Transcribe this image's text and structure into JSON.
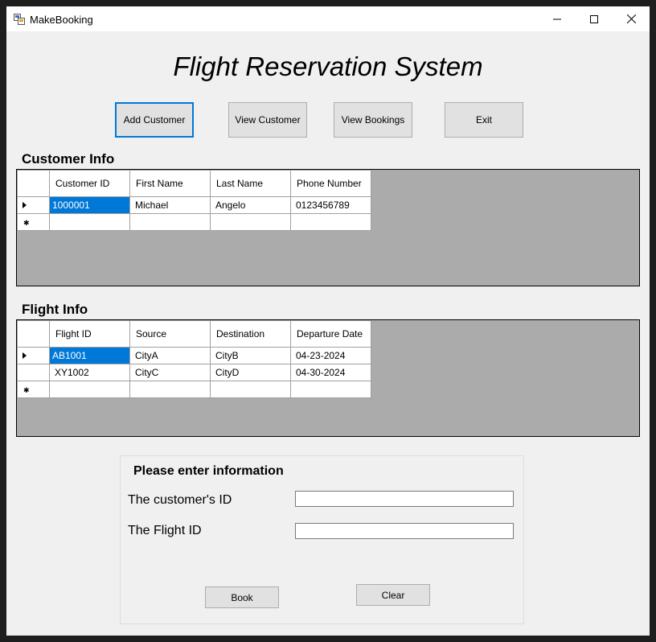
{
  "window": {
    "title": "MakeBooking",
    "controls": {
      "minimize": "—",
      "maximize": "☐",
      "close": "✕"
    }
  },
  "heading": "Flight Reservation System",
  "toolbar": {
    "add_customer": "Add Customer",
    "view_customer": "View Customer",
    "view_bookings": "View Bookings",
    "exit": "Exit"
  },
  "customer_info": {
    "title": "Customer Info",
    "columns": [
      "Customer ID",
      "First Name",
      "Last Name",
      "Phone Number"
    ],
    "rows": [
      [
        "1000001",
        "Michael",
        "Angelo",
        "0123456789"
      ]
    ]
  },
  "flight_info": {
    "title": "Flight Info",
    "columns": [
      "Flight ID",
      "Source",
      "Destination",
      "Departure Date"
    ],
    "rows": [
      [
        "AB1001",
        "CityA",
        "CityB",
        "04-23-2024"
      ],
      [
        "XY1002",
        "CityC",
        "CityD",
        "04-30-2024"
      ]
    ]
  },
  "form": {
    "heading": "Please enter information",
    "customer_id_label": "The customer's ID",
    "customer_id_value": "",
    "flight_id_label": "The Flight ID",
    "flight_id_value": "",
    "book_label": "Book",
    "clear_label": "Clear"
  },
  "colors": {
    "selection": "#0078d7",
    "grid_background": "#ababab",
    "form_background": "#f0f0f0"
  }
}
